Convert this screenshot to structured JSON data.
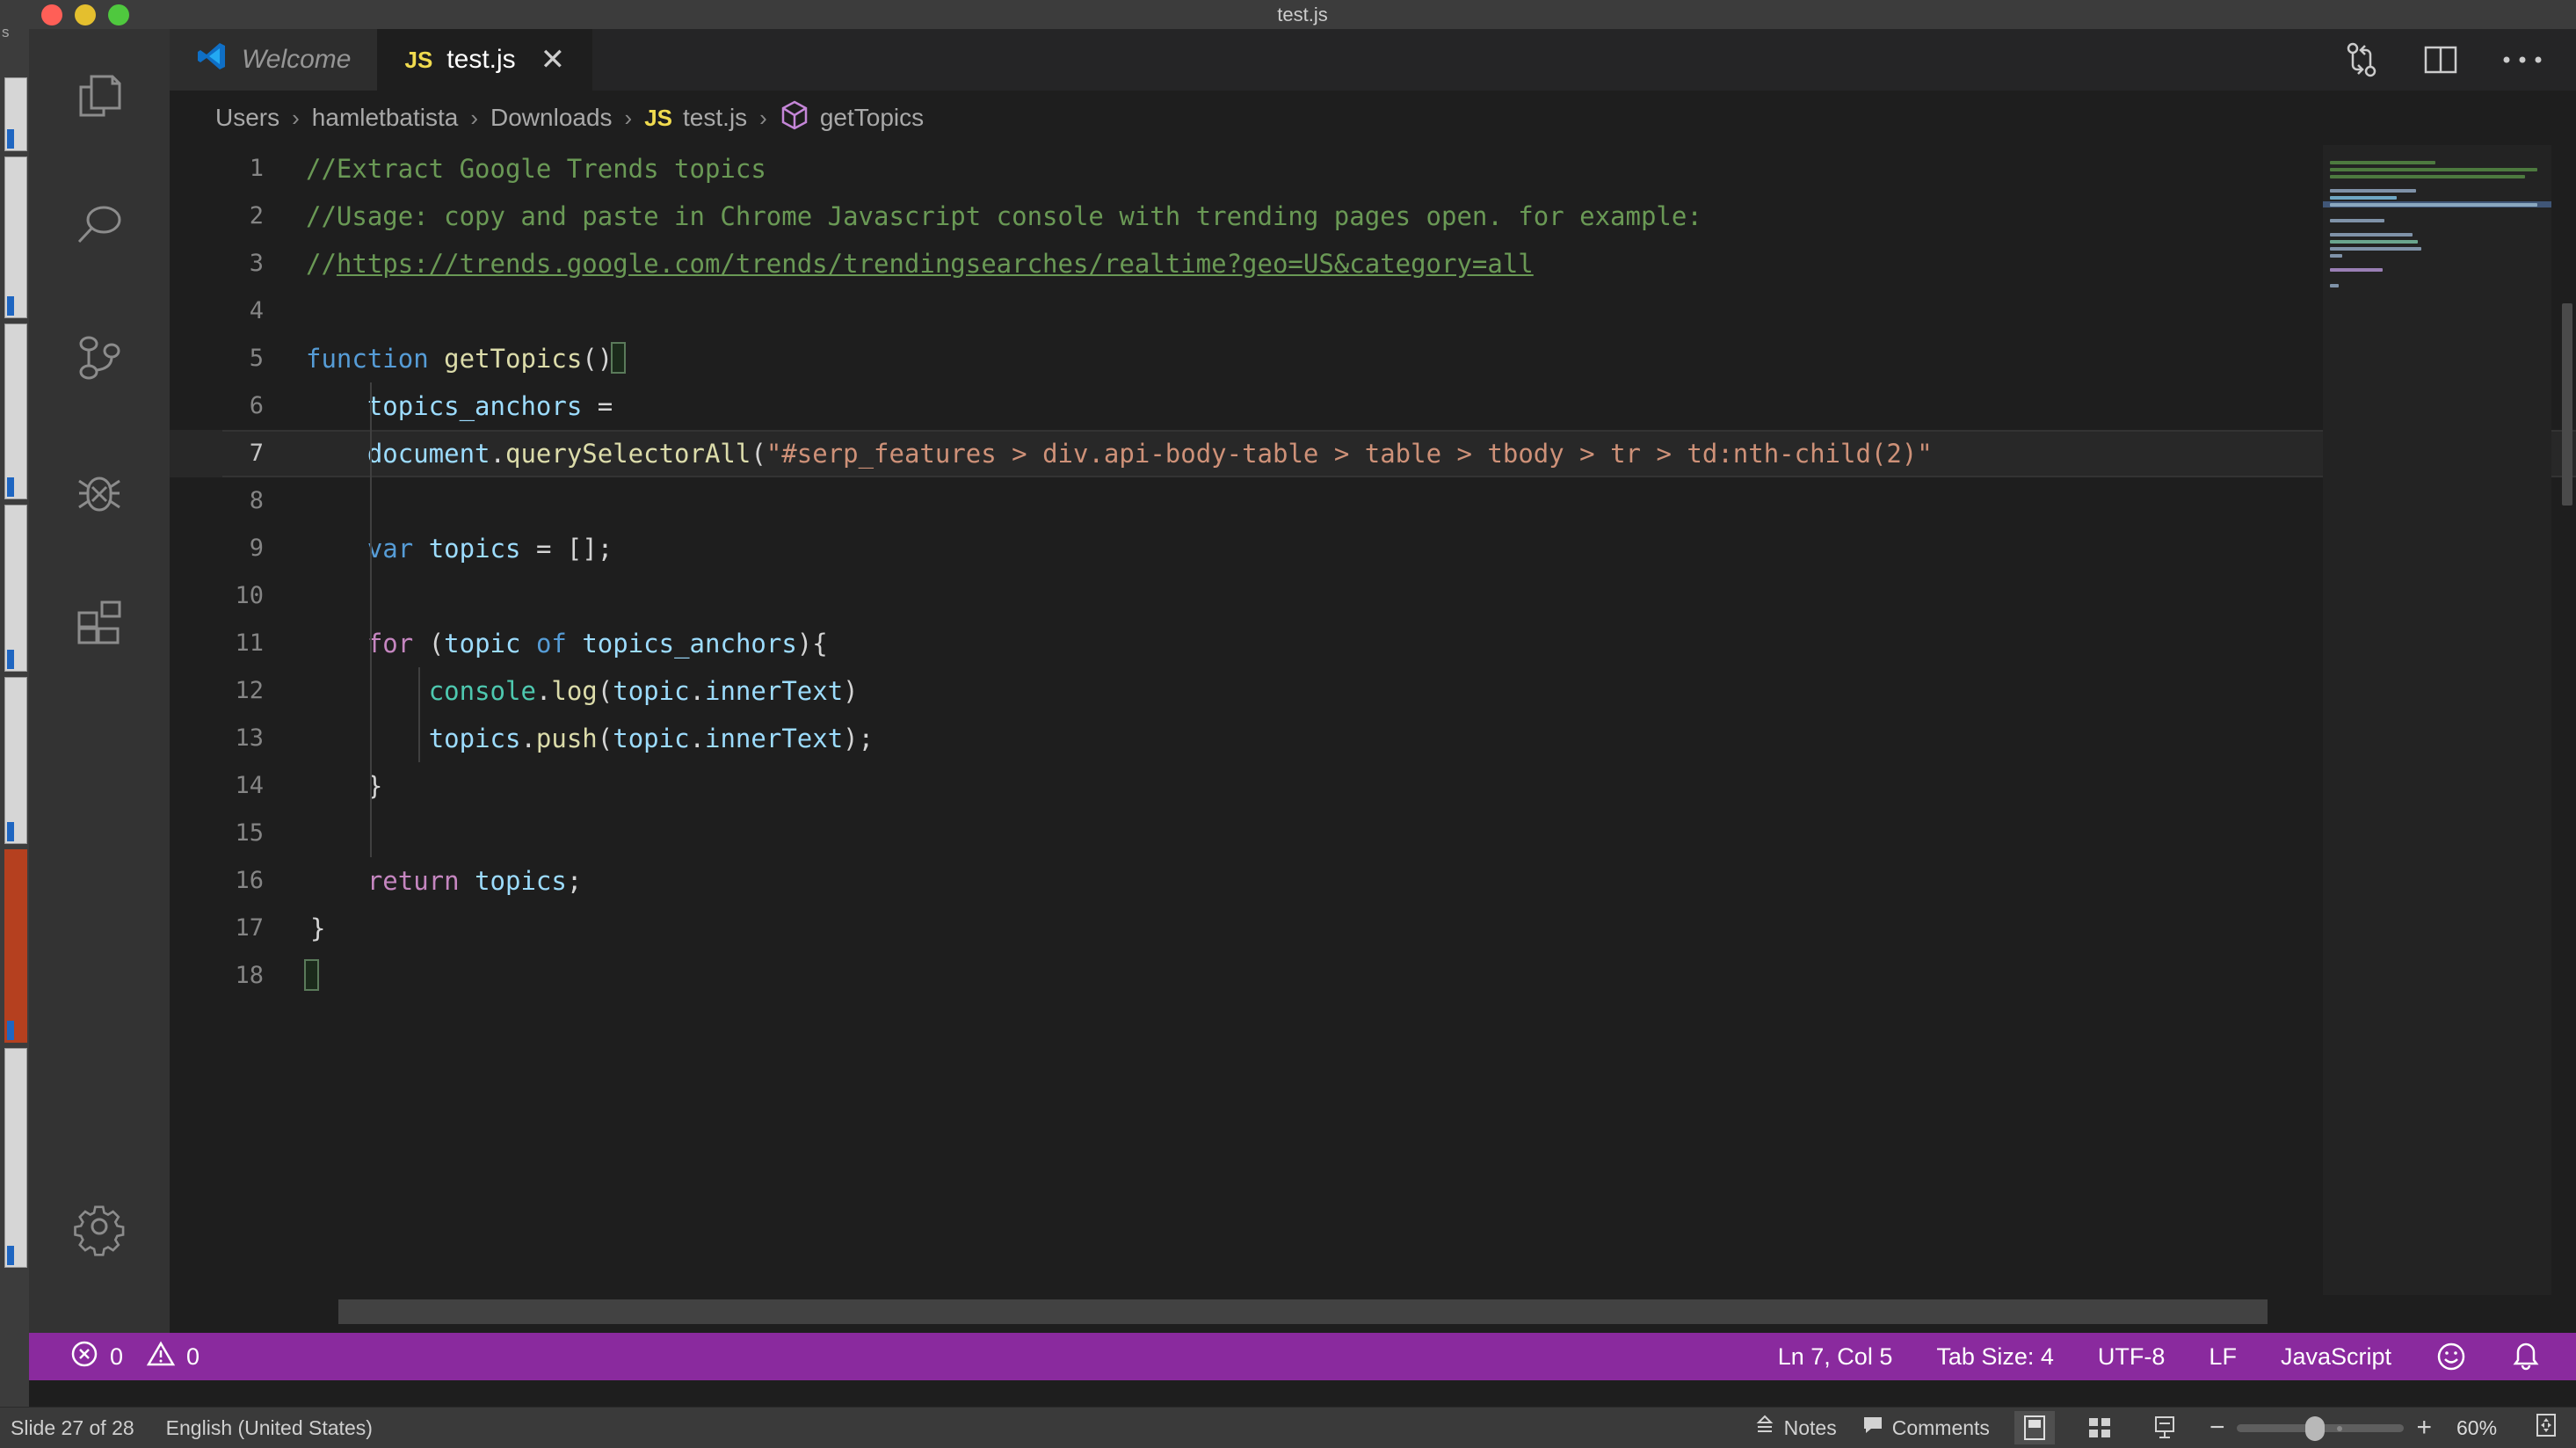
{
  "powerpoint": {
    "slide_status": "Slide 27 of 28",
    "language": "English (United States)",
    "notes_label": "Notes",
    "comments_label": "Comments",
    "zoom_level": "60%",
    "rail_label": "s"
  },
  "vscode": {
    "window_title": "test.js",
    "tabs": [
      {
        "label": "Welcome",
        "icon": "vscode-logo-icon",
        "active": false,
        "closable": false
      },
      {
        "label": "test.js",
        "icon": "js-file-icon",
        "badge": "JS",
        "active": true,
        "closable": true
      }
    ],
    "tab_actions": [
      {
        "name": "run-and-debug-icon"
      },
      {
        "name": "split-editor-icon"
      },
      {
        "name": "more-actions-icon"
      }
    ],
    "breadcrumb": [
      {
        "label": "Users"
      },
      {
        "label": "hamletbatista"
      },
      {
        "label": "Downloads"
      },
      {
        "label": "test.js",
        "badge": "JS"
      },
      {
        "label": "getTopics",
        "symbol": "symbol-method-icon"
      }
    ],
    "breadcrumb_separator": "›",
    "activity_bar": [
      {
        "name": "explorer-icon",
        "label": "Explorer"
      },
      {
        "name": "search-icon",
        "label": "Search"
      },
      {
        "name": "source-control-icon",
        "label": "Source Control"
      },
      {
        "name": "run-debug-icon",
        "label": "Run and Debug"
      },
      {
        "name": "extensions-icon",
        "label": "Extensions"
      },
      {
        "name": "gear-icon",
        "label": "Manage"
      }
    ],
    "status_bar": {
      "errors": "0",
      "warnings": "0",
      "cursor_position": "Ln 7, Col 5",
      "tab_size": "Tab Size: 4",
      "encoding": "UTF-8",
      "eol": "LF",
      "language_mode": "JavaScript",
      "feedback_icon": "smiley-icon",
      "notifications_icon": "bell-icon"
    },
    "colors": {
      "status_bar_bg": "#8a2a9e",
      "editor_bg": "#1e1e1e",
      "activity_bar_bg": "#333333",
      "tab_active_bg": "#1e1e1e",
      "tab_inactive_bg": "#2d2d2d",
      "comment_green": "#6a9955",
      "keyword_blue": "#569cd6",
      "keyword_purple": "#c586c0",
      "function_yellow": "#dcdcaa",
      "variable_blue": "#9cdcfe",
      "string_orange": "#ce9178"
    },
    "editor": {
      "filename": "test.js",
      "language": "JavaScript",
      "current_line": 7,
      "total_lines": 18,
      "lines": [
        {
          "n": "1",
          "text": "//Extract Google Trends topics"
        },
        {
          "n": "2",
          "text": "//Usage: copy and paste in Chrome Javascript console with trending pages open. for example:"
        },
        {
          "n": "3",
          "text": "//https://trends.google.com/trends/trendingsearches/realtime?geo=US&category=all"
        },
        {
          "n": "4",
          "text": ""
        },
        {
          "n": "5",
          "text": "function getTopics(){"
        },
        {
          "n": "6",
          "text": "    topics_anchors ="
        },
        {
          "n": "7",
          "text": "    document.querySelectorAll(\"#serp_features > div.api-body-table > table > tbody > tr > td:nth-child(2)\""
        },
        {
          "n": "8",
          "text": ""
        },
        {
          "n": "9",
          "text": "    var topics = [];"
        },
        {
          "n": "10",
          "text": ""
        },
        {
          "n": "11",
          "text": "    for (topic of topics_anchors){"
        },
        {
          "n": "12",
          "text": "        console.log(topic.innerText)"
        },
        {
          "n": "13",
          "text": "        topics.push(topic.innerText);"
        },
        {
          "n": "14",
          "text": "    }"
        },
        {
          "n": "15",
          "text": ""
        },
        {
          "n": "16",
          "text": "    return topics;"
        },
        {
          "n": "17",
          "text": ""
        },
        {
          "n": "18",
          "text": "}"
        }
      ]
    }
  }
}
